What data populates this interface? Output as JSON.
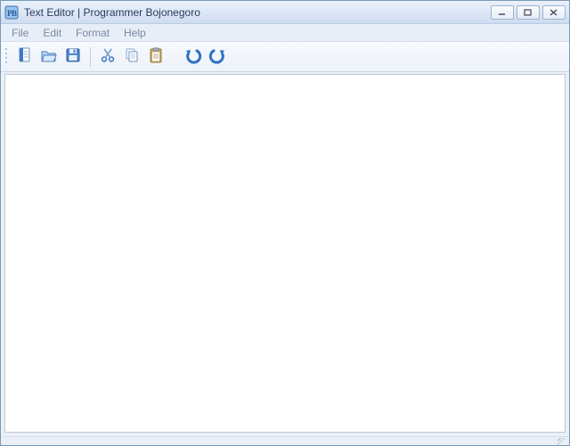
{
  "window": {
    "title": "Text Editor | Programmer Bojonegoro"
  },
  "menu": {
    "file": "File",
    "edit": "Edit",
    "format": "Format",
    "help": "Help"
  },
  "toolbar": {
    "new": "New",
    "open": "Open",
    "save": "Save",
    "cut": "Cut",
    "copy": "Copy",
    "paste": "Paste",
    "undo": "Undo",
    "redo": "Redo"
  },
  "editor": {
    "content": ""
  }
}
